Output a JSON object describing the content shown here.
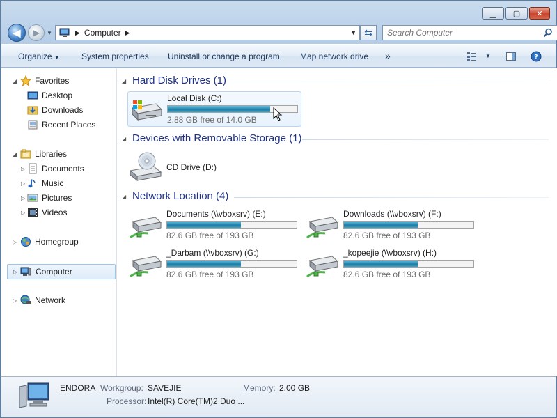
{
  "window": {
    "minimize_icon": "minimize-icon",
    "maximize_icon": "maximize-icon",
    "close_icon": "close-icon"
  },
  "address": {
    "crumb": "Computer"
  },
  "search": {
    "placeholder": "Search Computer"
  },
  "toolbar": {
    "organize": "Organize",
    "system_properties": "System properties",
    "uninstall": "Uninstall or change a program",
    "map_drive": "Map network drive",
    "more": "»"
  },
  "nav": {
    "favorites": "Favorites",
    "desktop": "Desktop",
    "downloads": "Downloads",
    "recent_places": "Recent Places",
    "libraries": "Libraries",
    "documents": "Documents",
    "music": "Music",
    "pictures": "Pictures",
    "videos": "Videos",
    "homegroup": "Homegroup",
    "computer": "Computer",
    "network": "Network"
  },
  "groups": {
    "hdd": "Hard Disk Drives (1)",
    "removable": "Devices with Removable Storage (1)",
    "network": "Network Location (4)"
  },
  "drives": {
    "c": {
      "name": "Local Disk (C:)",
      "free": "2.88 GB free of 14.0 GB",
      "used_fraction": 0.79
    },
    "d": {
      "name": "CD Drive (D:)"
    },
    "e": {
      "name": "Documents (\\\\vboxsrv) (E:)",
      "free": "82.6 GB free of 193 GB",
      "used_fraction": 0.57
    },
    "f": {
      "name": "Downloads (\\\\vboxsrv) (F:)",
      "free": "82.6 GB free of 193 GB",
      "used_fraction": 0.57
    },
    "g": {
      "name": "_Darbam (\\\\vboxsrv) (G:)",
      "free": "82.6 GB free of 193 GB",
      "used_fraction": 0.57
    },
    "h": {
      "name": "_kopeejie (\\\\vboxsrv) (H:)",
      "free": "82.6 GB free of 193 GB",
      "used_fraction": 0.57
    }
  },
  "details": {
    "computer_name": "ENDORA",
    "workgroup_label": "Workgroup:",
    "workgroup_value": "SAVEJIE",
    "memory_label": "Memory:",
    "memory_value": "2.00 GB",
    "processor_label": "Processor:",
    "processor_value": "Intel(R) Core(TM)2 Duo ..."
  }
}
